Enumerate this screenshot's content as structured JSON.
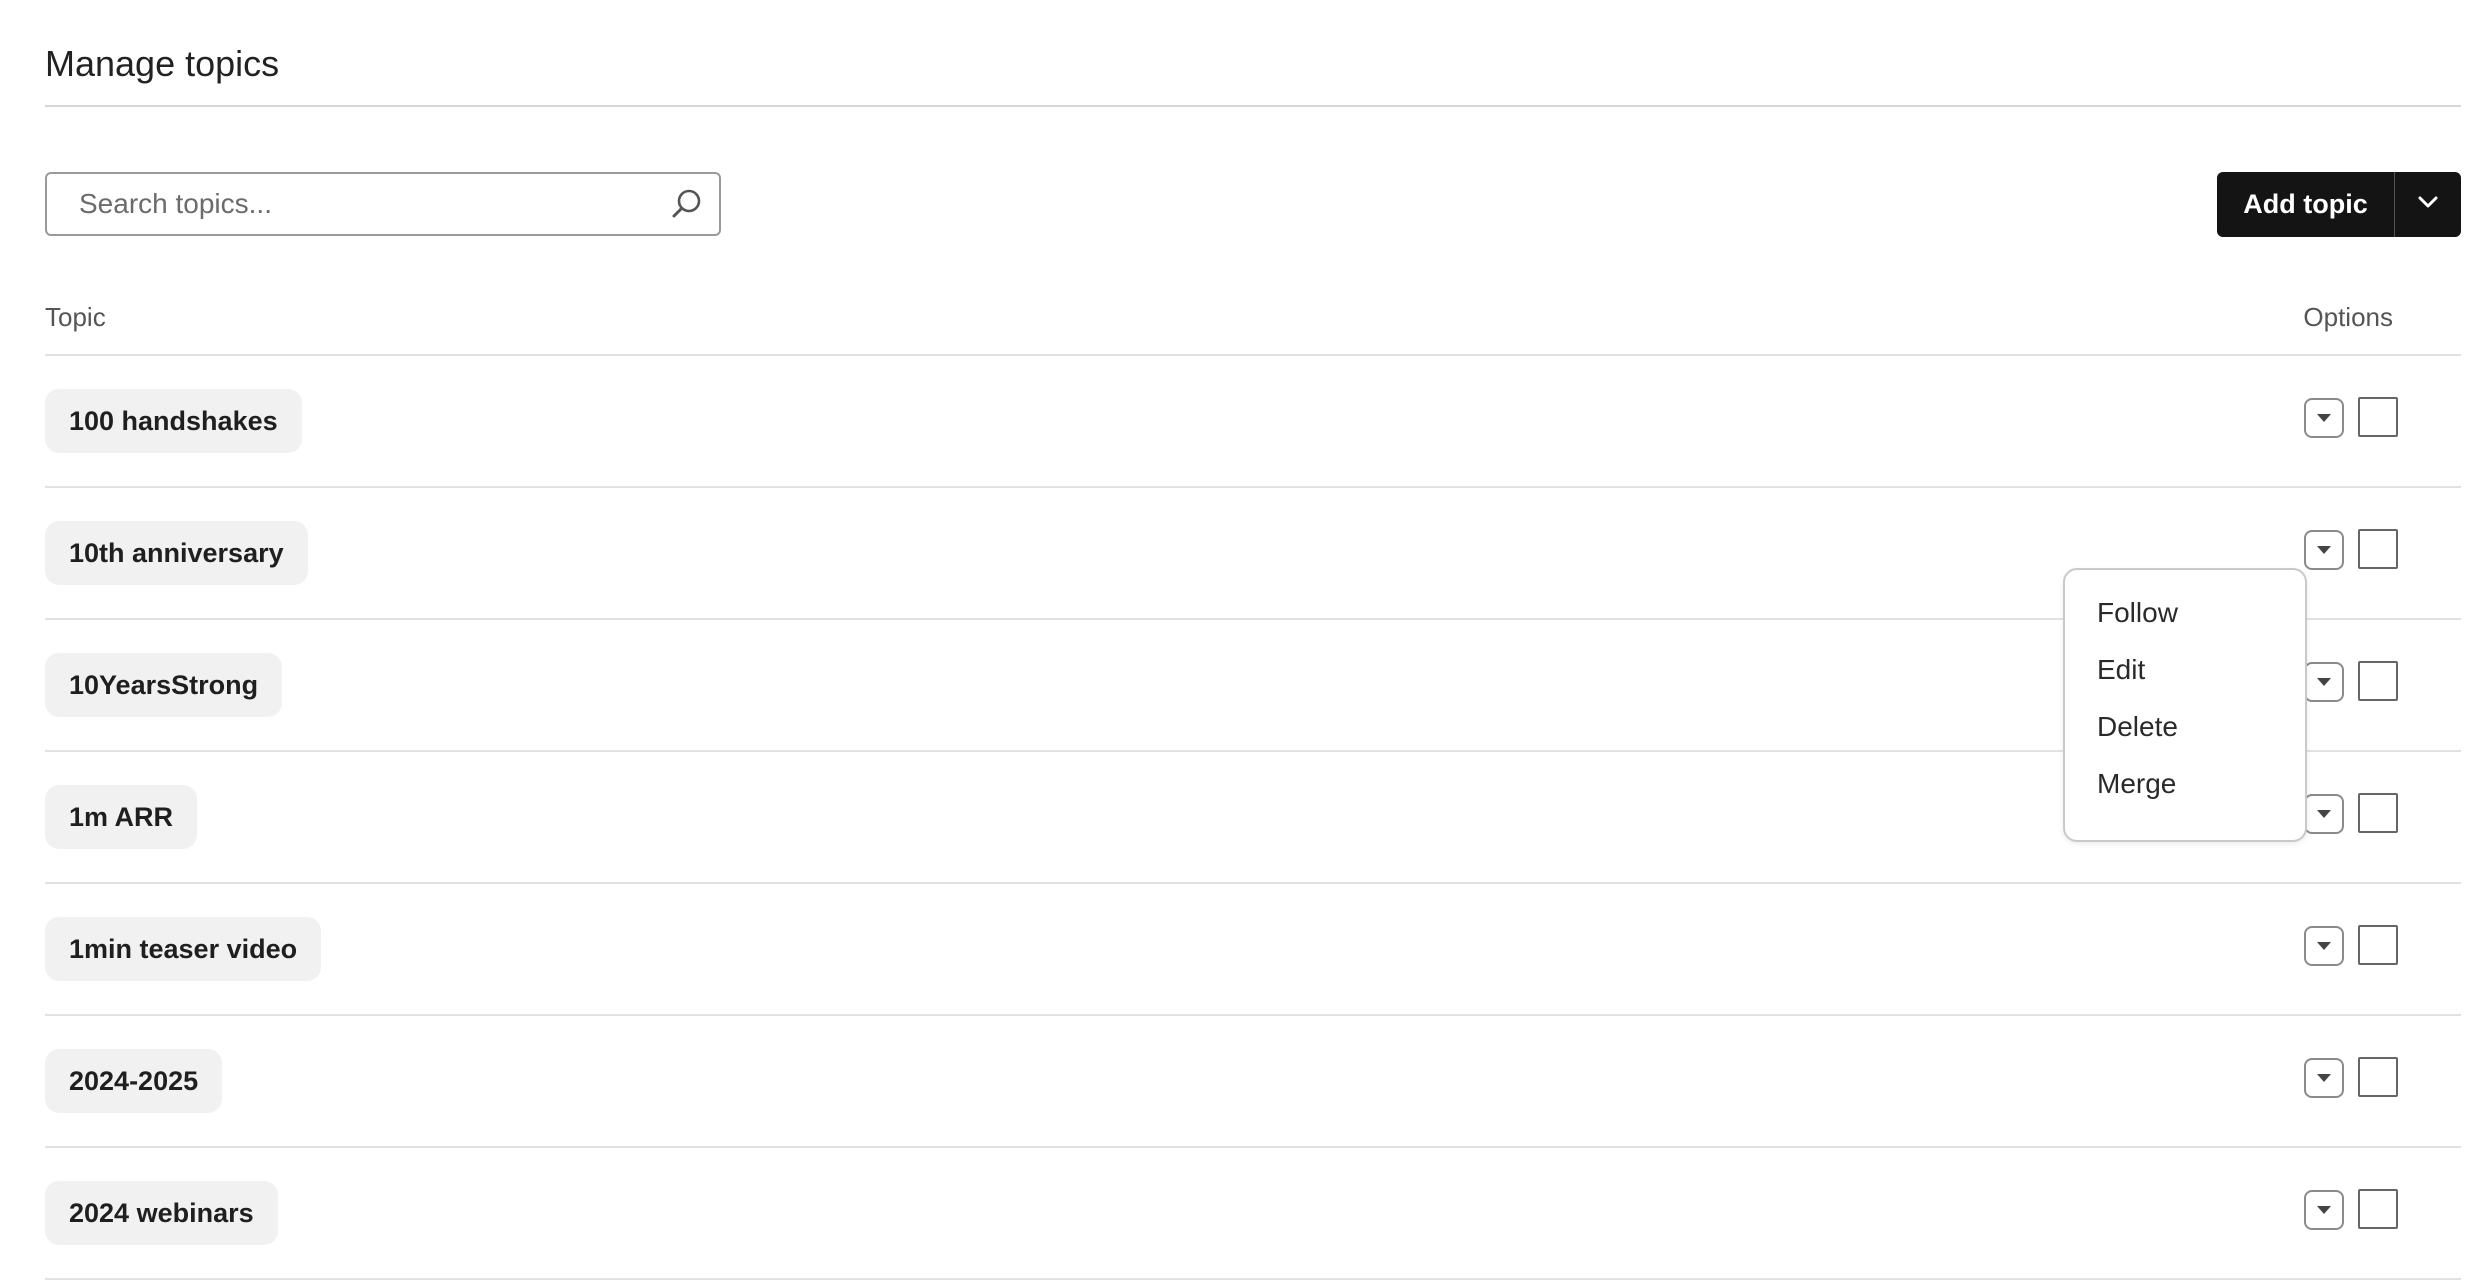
{
  "page": {
    "title": "Manage topics"
  },
  "search": {
    "placeholder": "Search topics..."
  },
  "toolbar": {
    "add_label": "Add topic"
  },
  "table": {
    "columns": {
      "topic": "Topic",
      "options": "Options"
    },
    "rows": [
      {
        "label": "100 handshakes"
      },
      {
        "label": "10th anniversary"
      },
      {
        "label": "10YearsStrong"
      },
      {
        "label": "1m ARR"
      },
      {
        "label": "1min teaser video"
      },
      {
        "label": "2024-2025"
      },
      {
        "label": "2024 webinars"
      }
    ]
  },
  "options_menu": {
    "open_for_row": "10th anniversary",
    "items": [
      {
        "label": "Follow"
      },
      {
        "label": "Edit"
      },
      {
        "label": "Delete"
      },
      {
        "label": "Merge"
      }
    ]
  },
  "colors": {
    "primary_button": "#141414",
    "pill_background": "#f1f1f1",
    "divider": "#e2e2e2"
  },
  "icons": {
    "search": "search-icon",
    "split_chevron": "chevron-down-icon",
    "row_options": "caret-down-icon"
  }
}
